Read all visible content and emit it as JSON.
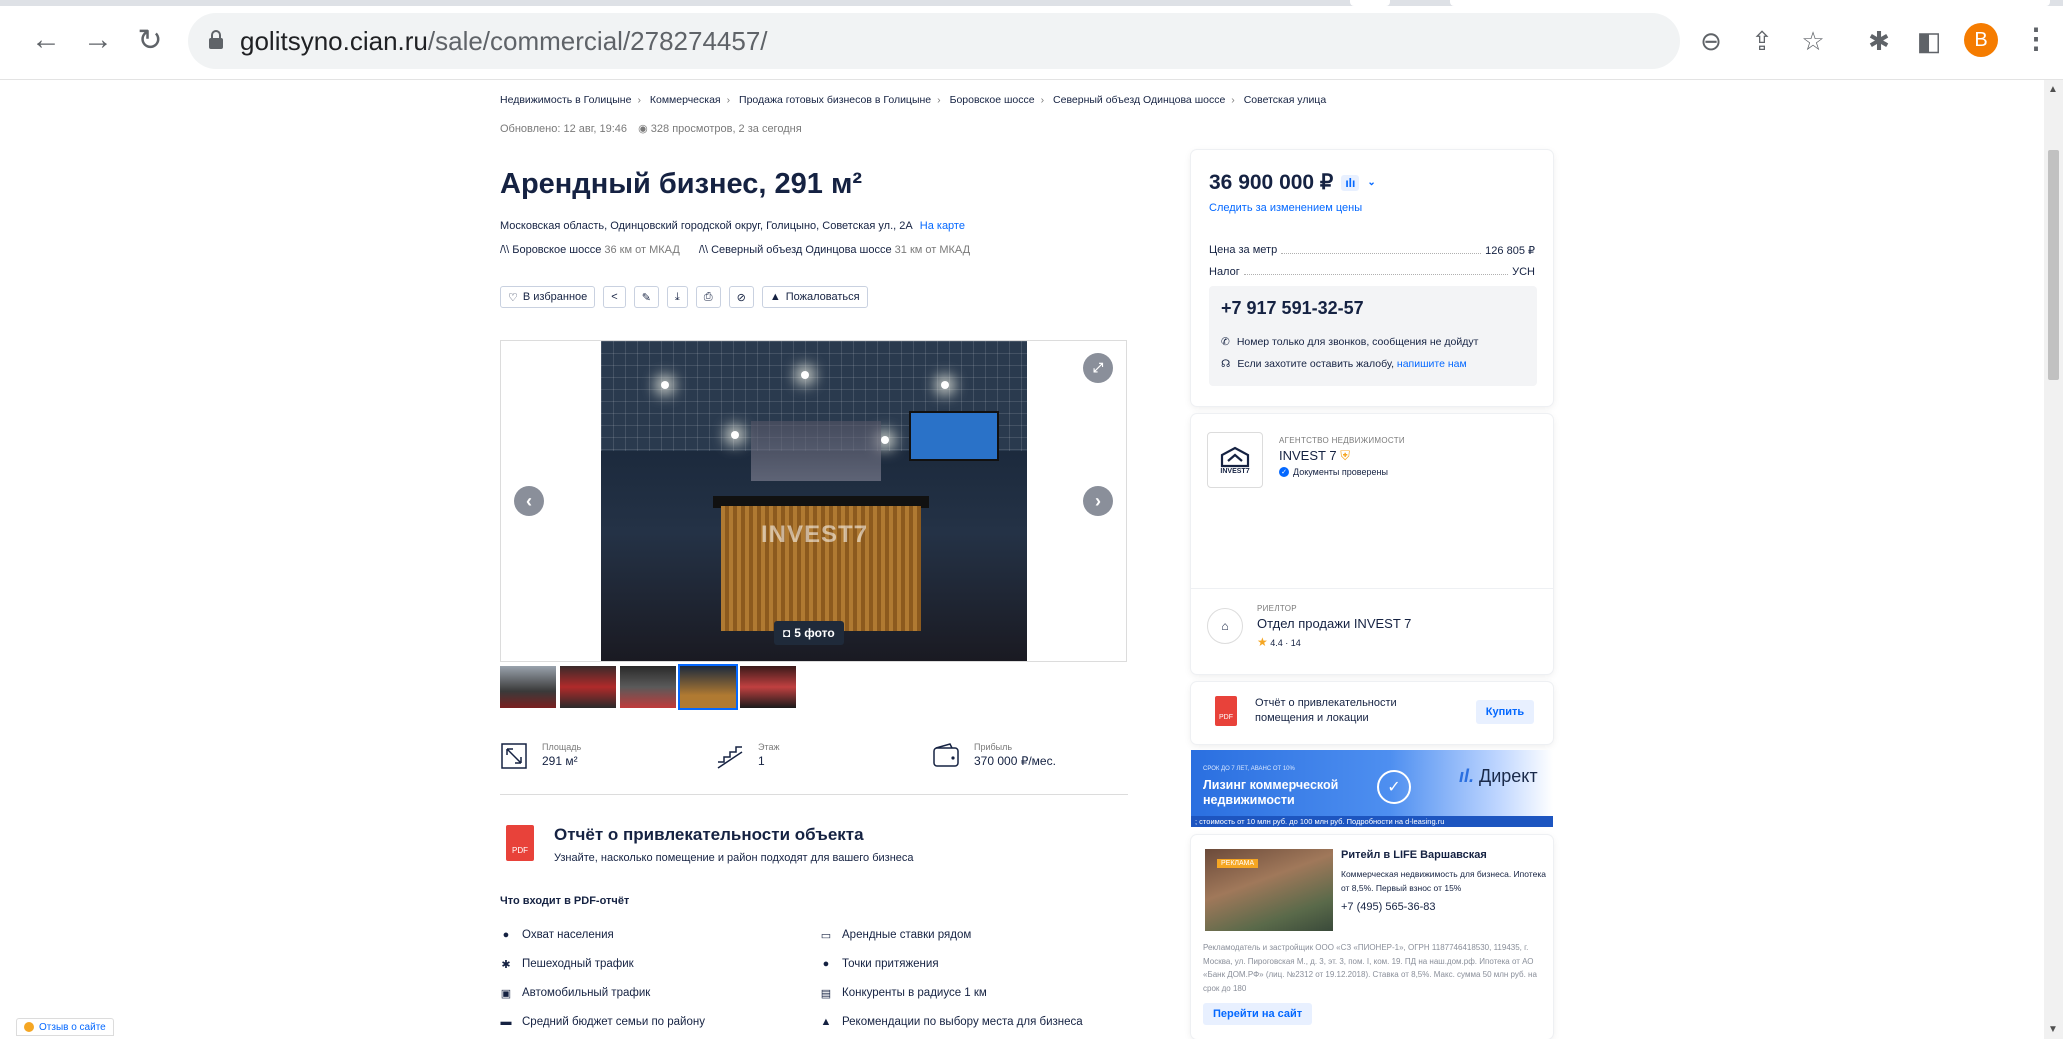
{
  "browser": {
    "url_host": "golitsyno.cian.ru",
    "url_path": "/sale/commercial/278274457/",
    "avatar_letter": "B",
    "accent": "#f57c00"
  },
  "breadcrumbs": [
    "Недвижимость в Голицыне",
    "Коммерческая",
    "Продажа готовых бизнесов в Голицыне",
    "Боровское шоссе",
    "Северный объезд Одинцова шоссе",
    "Советская улица"
  ],
  "meta": {
    "updated": "Обновлено: 12 авг, 19:46",
    "views": "328 просмотров, 2 за сегодня"
  },
  "listing": {
    "title": "Арендный бизнес, 291 м²",
    "address": "Московская область, Одинцовский городской округ, Голицыно, Советская ул., 2А",
    "map_link": "На карте",
    "highway1": "Боровское шоссе",
    "highway1_dist": "36 км от МКАД",
    "highway2": "Северный объезд Одинцова шоссе",
    "highway2_dist": "31 км от МКАД"
  },
  "actions": {
    "favorite": "В избранное",
    "complain": "Пожаловаться"
  },
  "gallery": {
    "watermark": "INVEST7",
    "photo_count": "5 фото"
  },
  "facts": [
    {
      "label": "Площадь",
      "value": "291 м²",
      "icon": "area-icon"
    },
    {
      "label": "Этаж",
      "value": "1",
      "icon": "floor-icon"
    },
    {
      "label": "Прибыль",
      "value": "370 000 ₽/мес.",
      "icon": "wallet-icon"
    }
  ],
  "report": {
    "title": "Отчёт о привлекательности объекта",
    "subtitle": "Узнайте, насколько помещение и район подходят для вашего бизнеса",
    "pdf_label": "PDF",
    "includes_heading": "Что входит в PDF-отчёт",
    "items_left": [
      "Охват населения",
      "Пешеходный трафик",
      "Автомобильный трафик",
      "Средний бюджет семьи по району"
    ],
    "items_right": [
      "Арендные ставки рядом",
      "Точки притяжения",
      "Конкуренты в радиусе 1 км",
      "Рекомендации по выбору места для бизнеса"
    ]
  },
  "price_card": {
    "price": "36 900 000 ₽",
    "watch": "Следить за изменением цены",
    "per_meter_label": "Цена за метр",
    "per_meter_value": "126 805 ₽",
    "tax_label": "Налог",
    "tax_value": "УСН",
    "phone": "+7 917 591-32-57",
    "note1": "Номер только для звонков, сообщения не дойдут",
    "note2_prefix": "Если захотите оставить жалобу,",
    "note2_link": "напишите нам"
  },
  "agency": {
    "kind": "АГЕНТСТВО НЕДВИЖИМОСТИ",
    "name": "INVEST 7",
    "verified": "Документы проверены",
    "logo_text": "INVEST7"
  },
  "realtor": {
    "kind": "РИЕЛТОР",
    "name": "Отдел продажи INVEST 7",
    "rating": "4.4 · 14"
  },
  "report_offer": {
    "text": "Отчёт о привлекательности помещения и локации",
    "pdf_label": "PDF",
    "button": "Купить"
  },
  "banner": {
    "small": "СРОК ДО 7 ЛЕТ, АВАНС ОТ 10%",
    "headline": "Лизинг коммерческой недвижимости",
    "footer": "; стоимость от 10 млн руб. до 100 млн руб. Подробности на d-leasing.ru",
    "brand": "Директ"
  },
  "ad": {
    "tag": "РЕКЛАМА",
    "title": "Ритейл в LIFE Варшавская",
    "desc": "Коммерческая недвижимость для бизнеса. Ипотека от 8,5%. Первый взнос от 15%",
    "phone": "+7 (495) 565-36-83",
    "legal": "Рекламодатель и застройщик ООО «СЗ «ПИОНЕР-1», ОГРН 1187746418530, 119435, г. Москва, ул. Пироговская М., д. 3, эт. 3, пом. I, ком. 19. ПД на наш.дом.рф. Ипотека от АО «Банк ДОМ.РФ» (лиц. №2312 от 19.12.2018). Ставка от 8,5%. Макс. сумма 50 млн руб. на срок до 180",
    "button": "Перейти на сайт"
  },
  "feedback": "Отзыв о сайте"
}
